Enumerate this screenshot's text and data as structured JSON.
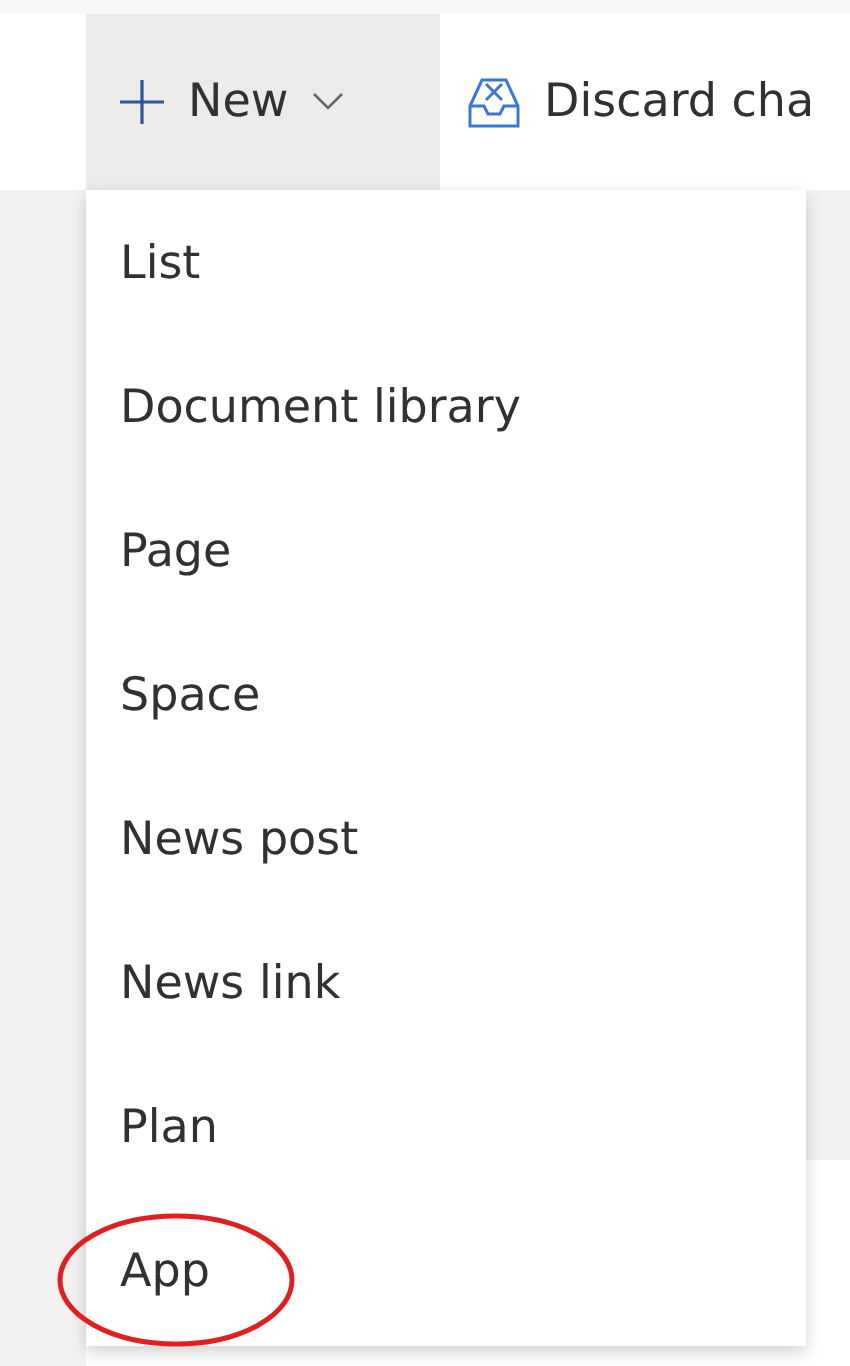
{
  "toolbar": {
    "new_button": {
      "label": "New",
      "expanded": true
    },
    "discard_button": {
      "label": "Discard cha"
    }
  },
  "menu": {
    "items": [
      {
        "label": "List",
        "circled": false
      },
      {
        "label": "Document library",
        "circled": false
      },
      {
        "label": "Page",
        "circled": false
      },
      {
        "label": "Space",
        "circled": false
      },
      {
        "label": "News post",
        "circled": false
      },
      {
        "label": "News link",
        "circled": false
      },
      {
        "label": "Plan",
        "circled": false
      },
      {
        "label": "App",
        "circled": true
      }
    ]
  }
}
